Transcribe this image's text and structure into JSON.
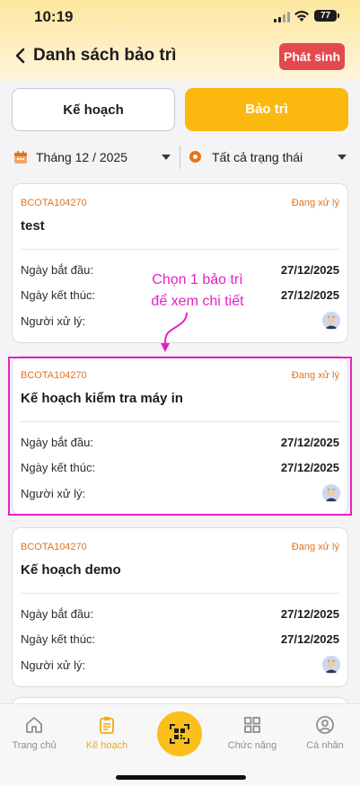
{
  "status_bar": {
    "time": "10:19",
    "battery": "77"
  },
  "header": {
    "title": "Danh sách bảo trì",
    "action_label": "Phát sinh"
  },
  "tabs": [
    {
      "label": "Kế hoạch",
      "active": false
    },
    {
      "label": "Bảo trì",
      "active": true
    }
  ],
  "filters": {
    "month": "Tháng 12 / 2025",
    "status": "Tất cả trạng thái"
  },
  "labels": {
    "start": "Ngày bắt đầu:",
    "end": "Ngày kết thúc:",
    "handler": "Người xử lý:"
  },
  "cards": [
    {
      "code": "BCOTA104270",
      "status": "Đang xử lý",
      "name": "test",
      "start": "27/12/2025",
      "end": "27/12/2025"
    },
    {
      "code": "BCOTA104270",
      "status": "Đang xử lý",
      "name": "Kế hoạch kiểm tra máy in",
      "start": "27/12/2025",
      "end": "27/12/2025"
    },
    {
      "code": "BCOTA104270",
      "status": "Đang xử lý",
      "name": "Kế hoạch demo",
      "start": "27/12/2025",
      "end": "27/12/2025"
    }
  ],
  "annotation": {
    "line1": "Chọn 1 bảo trì",
    "line2": "để xem chi tiết"
  },
  "bottom_nav": [
    {
      "label": "Trang chủ",
      "icon": "home-icon",
      "active": false
    },
    {
      "label": "Kế hoạch",
      "icon": "clipboard-icon",
      "active": true
    },
    {
      "label": "",
      "icon": "qr-code-icon",
      "active": false
    },
    {
      "label": "Chức năng",
      "icon": "grid-icon",
      "active": false
    },
    {
      "label": "Cá nhân",
      "icon": "user-icon",
      "active": false
    }
  ],
  "colors": {
    "accent": "#fbb80f",
    "status": "#e07420",
    "danger": "#e5484d",
    "annotation": "#e91ec8"
  }
}
